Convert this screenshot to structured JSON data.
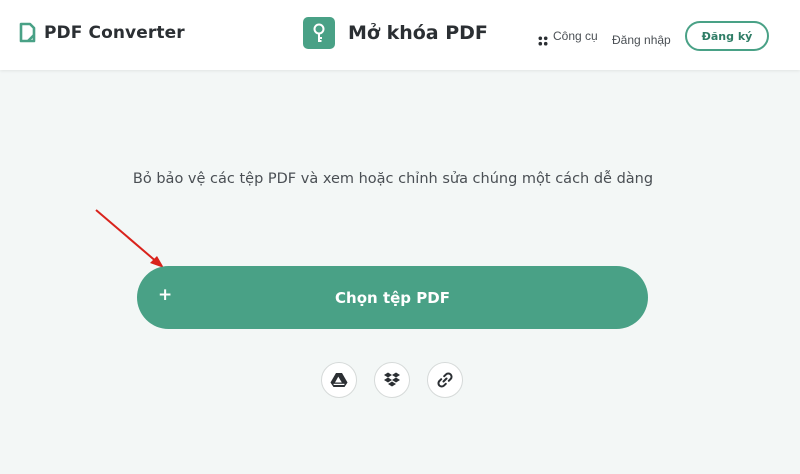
{
  "header": {
    "brand_name": "PDF Converter",
    "tool_title": "Mở khóa PDF",
    "nav": {
      "tools_label": "Công cụ",
      "login_label": "Đăng nhập",
      "signup_label": "Đăng ký"
    },
    "icons": {
      "brand": "pdf-converter-logo-icon",
      "tool": "key-icon",
      "tools": "grid-icon"
    }
  },
  "main": {
    "subtitle": "Bỏ bảo vệ các tệp PDF và xem hoặc chỉnh sửa chúng một cách dễ dàng",
    "choose_button": {
      "plus": "+",
      "label": "Chọn tệp PDF"
    },
    "sources": [
      {
        "icon": "google-drive-icon"
      },
      {
        "icon": "dropbox-icon"
      },
      {
        "icon": "link-icon"
      }
    ]
  },
  "colors": {
    "accent": "#49a186",
    "background": "#f3f7f6",
    "annotation_arrow": "#d9231c"
  }
}
